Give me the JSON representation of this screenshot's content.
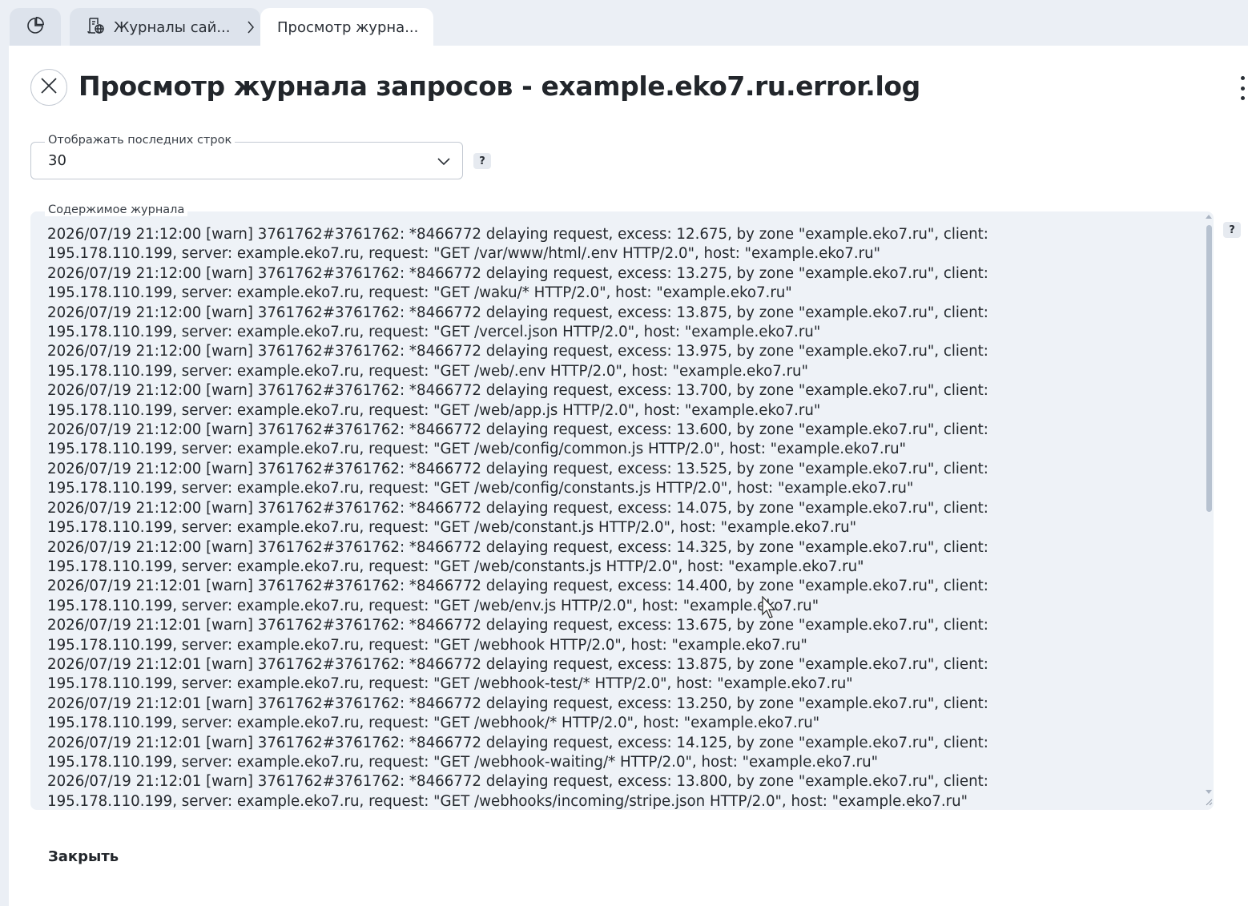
{
  "tabs": {
    "home_icon": "pie-chart-icon",
    "logs": {
      "label": "Журналы сай...",
      "icon": "logs-globe-icon"
    },
    "view": {
      "label": "Просмотр журна..."
    }
  },
  "dialog": {
    "title": "Просмотр журнала запросов - example.eko7.ru.error.log",
    "close_icon": "close-icon",
    "menu_icon": "more-vertical-icon"
  },
  "lines_select": {
    "label": "Отображать последних строк",
    "value": "30",
    "help": "?"
  },
  "log": {
    "label": "Содержимое журнала",
    "help": "?",
    "lines": [
      "2026/07/19 21:12:00 [warn] 3761762#3761762: *8466772 delaying request, excess: 12.675, by zone \"example.eko7.ru\", client: 195.178.110.199, server: example.eko7.ru, request: \"GET /var/www/html/.env HTTP/2.0\", host: \"example.eko7.ru\"",
      "2026/07/19 21:12:00 [warn] 3761762#3761762: *8466772 delaying request, excess: 13.275, by zone \"example.eko7.ru\", client: 195.178.110.199, server: example.eko7.ru, request: \"GET /waku/* HTTP/2.0\", host: \"example.eko7.ru\"",
      "2026/07/19 21:12:00 [warn] 3761762#3761762: *8466772 delaying request, excess: 13.875, by zone \"example.eko7.ru\", client: 195.178.110.199, server: example.eko7.ru, request: \"GET /vercel.json HTTP/2.0\", host: \"example.eko7.ru\"",
      "2026/07/19 21:12:00 [warn] 3761762#3761762: *8466772 delaying request, excess: 13.975, by zone \"example.eko7.ru\", client: 195.178.110.199, server: example.eko7.ru, request: \"GET /web/.env HTTP/2.0\", host: \"example.eko7.ru\"",
      "2026/07/19 21:12:00 [warn] 3761762#3761762: *8466772 delaying request, excess: 13.700, by zone \"example.eko7.ru\", client: 195.178.110.199, server: example.eko7.ru, request: \"GET /web/app.js HTTP/2.0\", host: \"example.eko7.ru\"",
      "2026/07/19 21:12:00 [warn] 3761762#3761762: *8466772 delaying request, excess: 13.600, by zone \"example.eko7.ru\", client: 195.178.110.199, server: example.eko7.ru, request: \"GET /web/config/common.js HTTP/2.0\", host: \"example.eko7.ru\"",
      "2026/07/19 21:12:00 [warn] 3761762#3761762: *8466772 delaying request, excess: 13.525, by zone \"example.eko7.ru\", client: 195.178.110.199, server: example.eko7.ru, request: \"GET /web/config/constants.js HTTP/2.0\", host: \"example.eko7.ru\"",
      "2026/07/19 21:12:00 [warn] 3761762#3761762: *8466772 delaying request, excess: 14.075, by zone \"example.eko7.ru\", client: 195.178.110.199, server: example.eko7.ru, request: \"GET /web/constant.js HTTP/2.0\", host: \"example.eko7.ru\"",
      "2026/07/19 21:12:00 [warn] 3761762#3761762: *8466772 delaying request, excess: 14.325, by zone \"example.eko7.ru\", client: 195.178.110.199, server: example.eko7.ru, request: \"GET /web/constants.js HTTP/2.0\", host: \"example.eko7.ru\"",
      "2026/07/19 21:12:01 [warn] 3761762#3761762: *8466772 delaying request, excess: 14.400, by zone \"example.eko7.ru\", client: 195.178.110.199, server: example.eko7.ru, request: \"GET /web/env.js HTTP/2.0\", host: \"example.eko7.ru\"",
      "2026/07/19 21:12:01 [warn] 3761762#3761762: *8466772 delaying request, excess: 13.675, by zone \"example.eko7.ru\", client: 195.178.110.199, server: example.eko7.ru, request: \"GET /webhook HTTP/2.0\", host: \"example.eko7.ru\"",
      "2026/07/19 21:12:01 [warn] 3761762#3761762: *8466772 delaying request, excess: 13.875, by zone \"example.eko7.ru\", client: 195.178.110.199, server: example.eko7.ru, request: \"GET /webhook-test/* HTTP/2.0\", host: \"example.eko7.ru\"",
      "2026/07/19 21:12:01 [warn] 3761762#3761762: *8466772 delaying request, excess: 13.250, by zone \"example.eko7.ru\", client: 195.178.110.199, server: example.eko7.ru, request: \"GET /webhook/* HTTP/2.0\", host: \"example.eko7.ru\"",
      "2026/07/19 21:12:01 [warn] 3761762#3761762: *8466772 delaying request, excess: 14.125, by zone \"example.eko7.ru\", client: 195.178.110.199, server: example.eko7.ru, request: \"GET /webhook-waiting/* HTTP/2.0\", host: \"example.eko7.ru\"",
      "2026/07/19 21:12:01 [warn] 3761762#3761762: *8466772 delaying request, excess: 13.800, by zone \"example.eko7.ru\", client: 195.178.110.199, server: example.eko7.ru, request: \"GET /webhooks/incoming/stripe.json HTTP/2.0\", host: \"example.eko7.ru\""
    ]
  },
  "footer": {
    "close_label": "Закрыть"
  },
  "colors": {
    "background": "#ebeff5",
    "panel": "#ffffff",
    "log_bg": "#eef2f7",
    "scroll_thumb": "#b7c2d0"
  }
}
